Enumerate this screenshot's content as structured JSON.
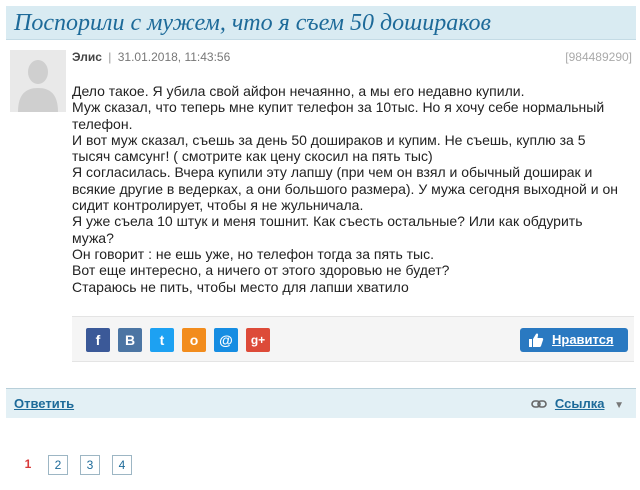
{
  "page": {
    "title": "Поспорили с мужем, что я съем 50 дошираков"
  },
  "post": {
    "author": "Элис",
    "separator": "|",
    "datetime": "31.01.2018, 11:43:56",
    "id": "[984489290]",
    "lines": [
      "Дело такое. Я убила свой айфон нечаянно, а мы его недавно купили.",
      "Муж сказал, что теперь мне купит телефон за 10тыс. Но я хочу себе нормальный",
      "телефон.",
      "И вот муж сказал, съешь за день 50 дошираков и купим. Не съешь, куплю за 5",
      "тысяч самсунг! ( смотрите как цену скосил на пять тыс)",
      "Я согласилась. Вчера купили эту лапшу (при чем он взял и обычный доширак и",
      "всякие другие в ведерках, а они большого размера). У мужа сегодня выходной и он",
      "сидит контролирует, чтобы я не жульничала.",
      "Я уже съела 10 штук и меня тошнит. Как съесть остальные? Или как обдурить",
      "мужа?",
      "Он говорит : не ешь уже, но телефон тогда за пять тыс.",
      "Вот еще интересно, а ничего от этого здоровью не будет?",
      "Стараюсь не пить, чтобы место для лапши хватило"
    ]
  },
  "share": {
    "facebook": "f",
    "vkontakte": "В",
    "twitter": "t",
    "odnoklassniki": "о",
    "mail": "@",
    "googleplus": "g+",
    "like_label": "Нравится"
  },
  "actions": {
    "reply_label": "Ответить",
    "link_label": "Ссылка"
  },
  "pagination": {
    "current": "1",
    "pages": [
      "2",
      "3",
      "4"
    ]
  },
  "colors": {
    "accent": "#1d6a99",
    "title_bg": "#d9ebf2",
    "like_bg": "#2a79c1",
    "facebook": "#3b5998",
    "vkontakte": "#4c75a3",
    "twitter": "#1da1f2",
    "odnoklassniki": "#f28c1d",
    "mail": "#168de2",
    "googleplus": "#dd4b39"
  }
}
